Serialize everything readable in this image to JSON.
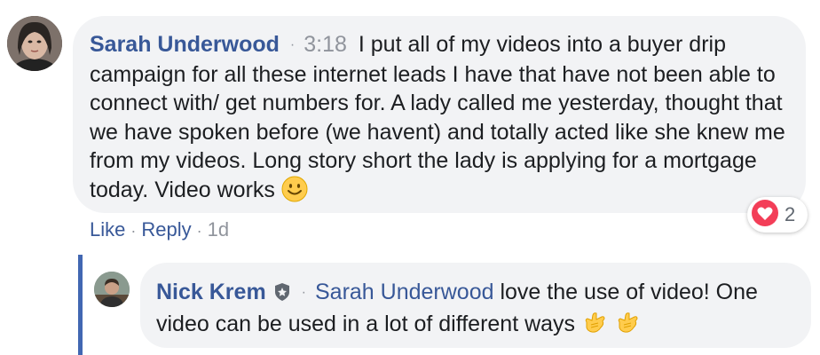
{
  "comment": {
    "author": "Sarah Underwood",
    "separator": "·",
    "time": "3:18",
    "text": "I put all of my videos into a buyer drip campaign for all these internet leads I have that have not been able to connect with/ get numbers for. A lady called me yesterday, thought that we have spoken before (we havent) and totally acted like she knew me from my videos. Long story short the lady is applying for a mortgage today. Video works",
    "emoji": "slightly-smiling-face",
    "reaction": {
      "icon": "heart-icon",
      "count": "2",
      "color": "#f33e58"
    },
    "actions": {
      "like": "Like",
      "reply": "Reply",
      "sep": "·",
      "age": "1d"
    }
  },
  "reply": {
    "author": "Nick Krem",
    "badge": "shield-badge-icon",
    "separator": "·",
    "mention": "Sarah Underwood",
    "text": "love the use of video! One video can be used in a lot of different ways",
    "emojis": [
      "call-me-hand",
      "call-me-hand"
    ]
  },
  "colors": {
    "link": "#385898",
    "bubble": "#f2f3f5",
    "muted": "#90949c",
    "thread": "#4267b2"
  }
}
